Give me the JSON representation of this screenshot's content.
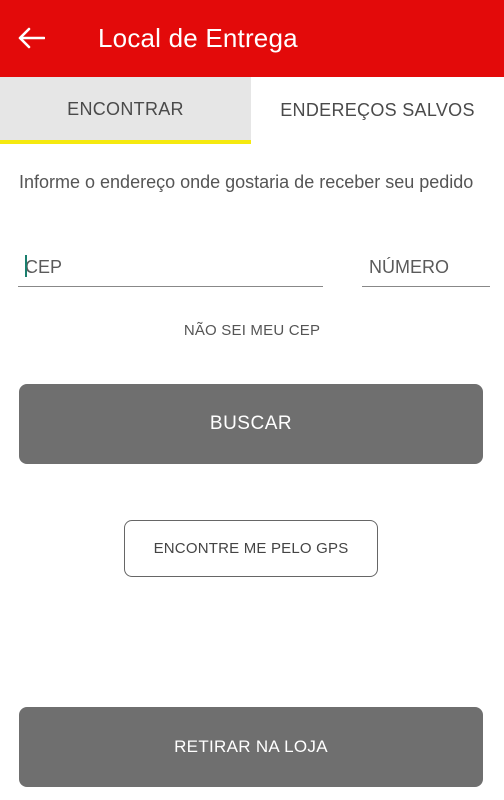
{
  "appbar": {
    "title": "Local de Entrega",
    "back_icon": "arrow-left-icon",
    "background_color": "#e30a0a"
  },
  "tabs": [
    {
      "label": "ENCONTRAR",
      "active": true
    },
    {
      "label": "ENDEREÇOS SALVOS",
      "active": false
    }
  ],
  "tab_indicator_color": "#f5e90f",
  "form": {
    "instructions": "Informe o endereço onde gostaria de receber seu pedido",
    "cep_placeholder": "CEP",
    "cep_value": "",
    "number_placeholder": "NÚMERO",
    "number_value": "",
    "unknown_cep_link": "NÃO SEI MEU CEP"
  },
  "buttons": {
    "search": "BUSCAR",
    "gps": "ENCONTRE ME PELO GPS",
    "pickup": "RETIRAR NA LOJA"
  }
}
